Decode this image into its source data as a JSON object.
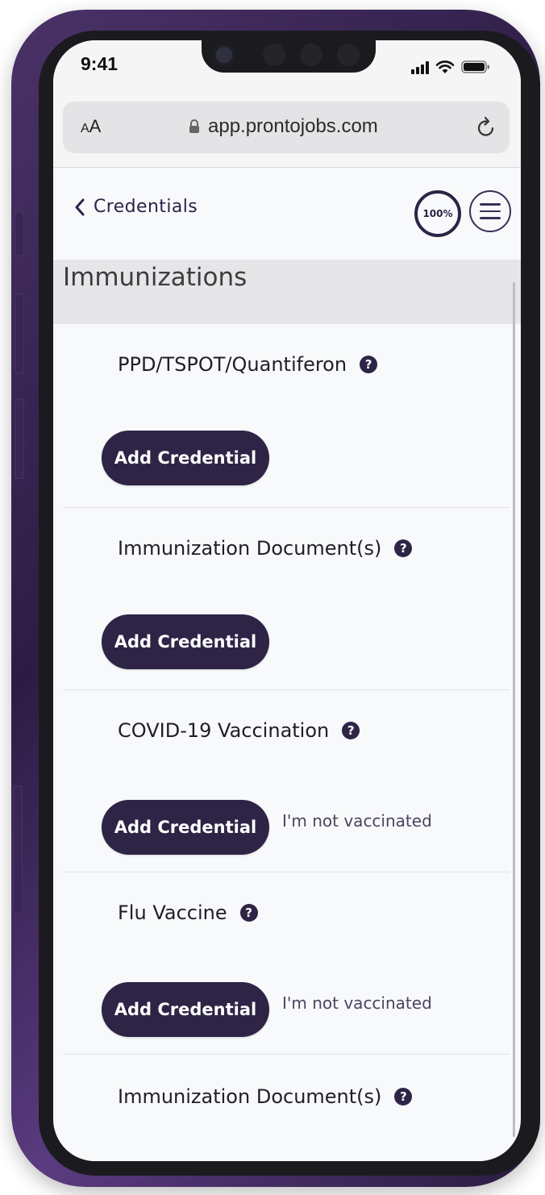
{
  "status_bar": {
    "time": "9:41"
  },
  "browser": {
    "text_size_label": "AA",
    "url": "app.prontojobs.com"
  },
  "header": {
    "back_label": "Credentials",
    "progress": "100%"
  },
  "section": {
    "title": "Immunizations"
  },
  "credentials": [
    {
      "title": "PPD/TSPOT/Quantiferon",
      "button": "Add Credential",
      "secondary": ""
    },
    {
      "title": "Immunization Document(s)",
      "button": "Add Credential",
      "secondary": ""
    },
    {
      "title": "COVID-19 Vaccination",
      "button": "Add Credential",
      "secondary": "I'm not vaccinated"
    },
    {
      "title": "Flu Vaccine",
      "button": "Add Credential",
      "secondary": "I'm not vaccinated"
    },
    {
      "title": "Immunization Document(s)",
      "button": "",
      "secondary": ""
    }
  ],
  "colors": {
    "brand": "#2e2446",
    "phone_frame": "#4b3268",
    "background": "#f7f9fb",
    "section_band": "#e6e6e8"
  },
  "icons": {
    "back": "chevron-left-icon",
    "menu": "hamburger-menu-icon",
    "help": "question-circle-icon",
    "lock": "lock-icon",
    "reload": "reload-icon",
    "signal": "signal-icon",
    "wifi": "wifi-icon",
    "battery": "battery-icon"
  }
}
